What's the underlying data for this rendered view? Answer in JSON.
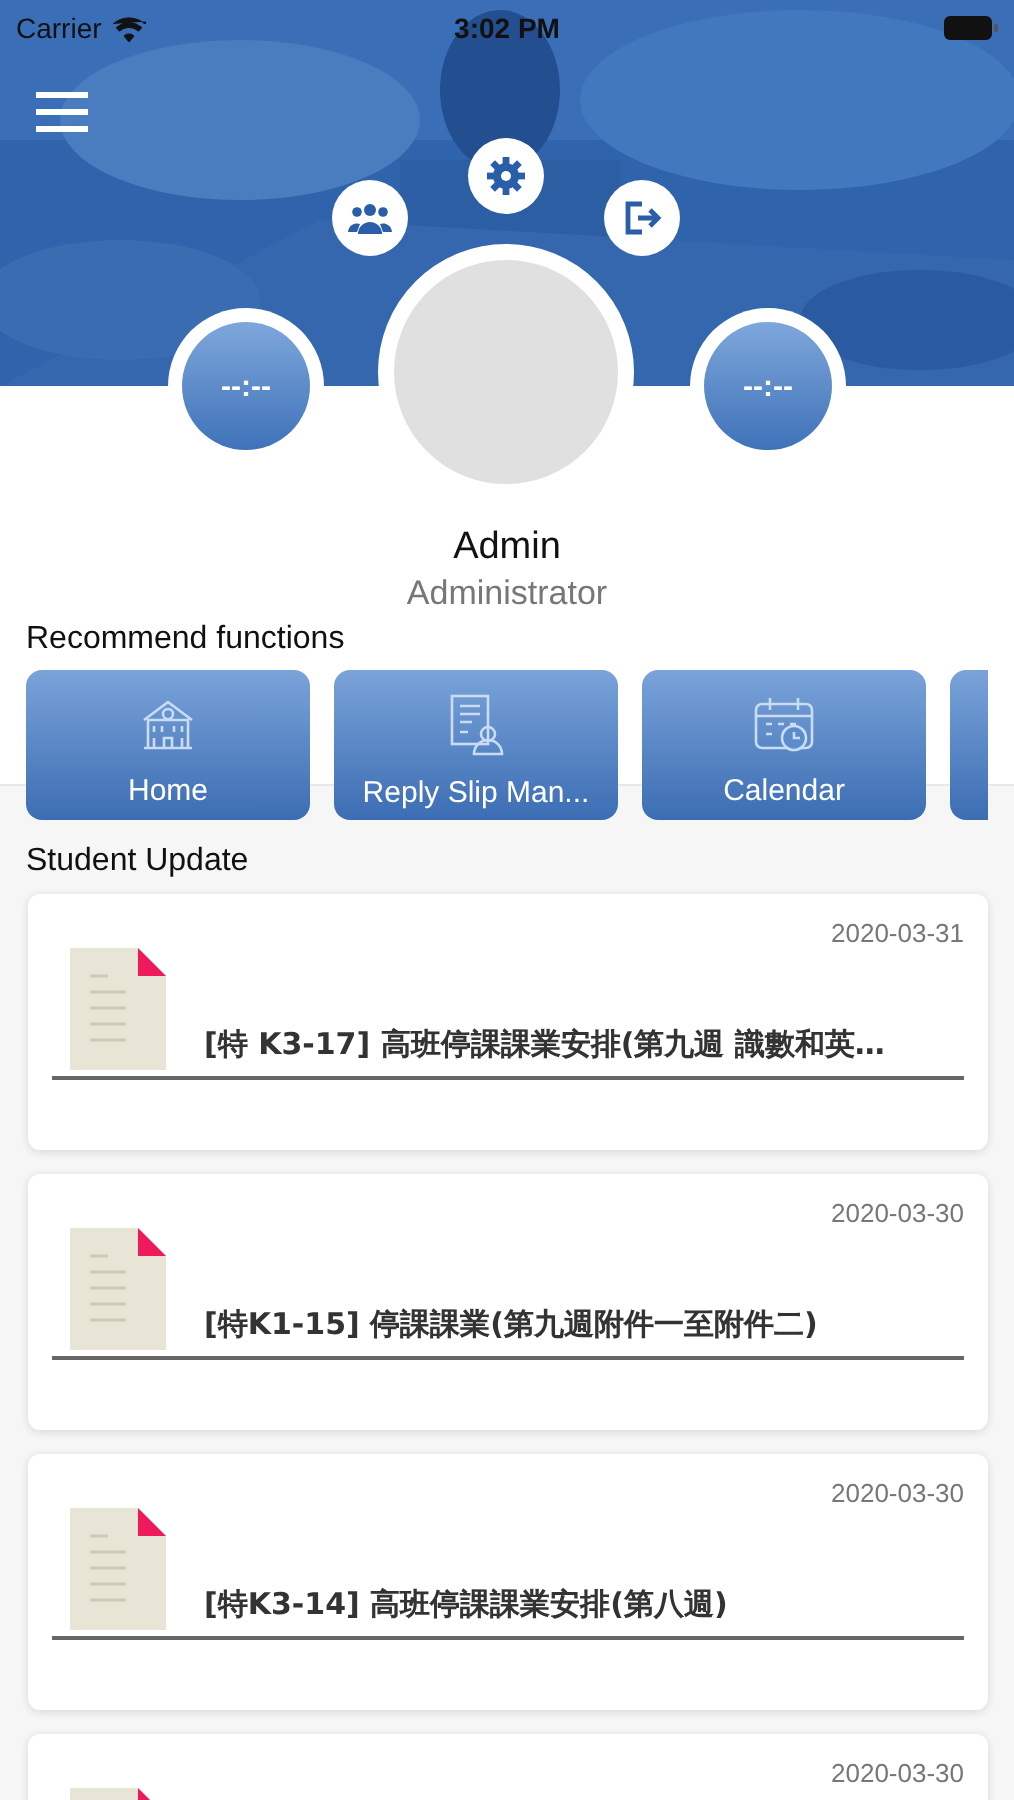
{
  "status_bar": {
    "carrier": "Carrier",
    "time": "3:02 PM"
  },
  "profile": {
    "left_time": "--:--",
    "right_time": "--:--",
    "name": "Admin",
    "role": "Administrator"
  },
  "recommend": {
    "heading": "Recommend functions",
    "items": [
      {
        "kind": "tile",
        "label": "Home"
      },
      {
        "kind": "tile",
        "label": "Reply Slip Man..."
      },
      {
        "kind": "tile",
        "label": "Calendar"
      },
      {
        "kind": "cut"
      }
    ]
  },
  "updates": {
    "heading": "Student Update",
    "items": [
      {
        "date": "2020-03-31",
        "title": "[特 K3-17] 高班停課課業安排(第九週 識數和英…"
      },
      {
        "date": "2020-03-30",
        "title": "[特K1-15] 停課課業(第九週附件一至附件二)"
      },
      {
        "date": "2020-03-30",
        "title": "[特K3-14] 高班停課課業安排(第八週)"
      },
      {
        "date": "2020-03-30"
      }
    ]
  }
}
